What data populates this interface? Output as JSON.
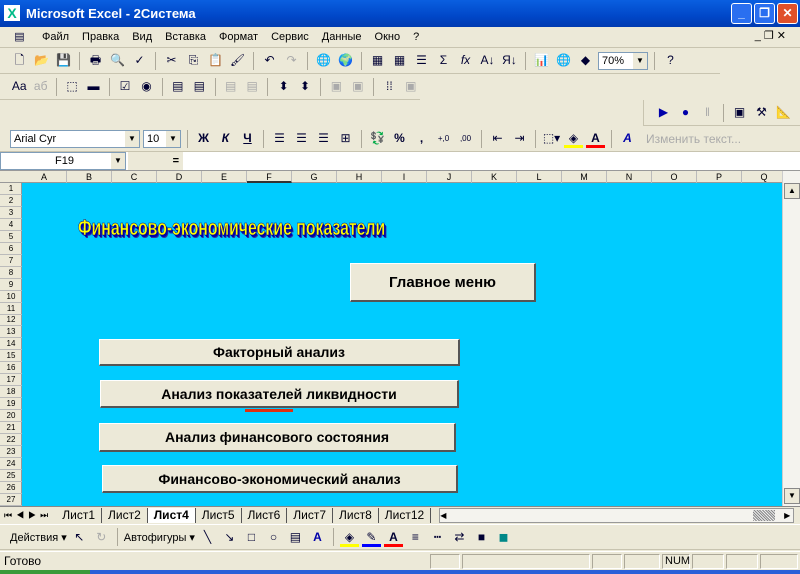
{
  "window": {
    "title": "Microsoft Excel - 2Система"
  },
  "menu": [
    "Файл",
    "Правка",
    "Вид",
    "Вставка",
    "Формат",
    "Сервис",
    "Данные",
    "Окно",
    "?"
  ],
  "toolbar": {
    "zoom": "70%",
    "font": "Arial Cyr",
    "size": "10",
    "bold": "Ж",
    "italic": "К",
    "underline": "Ч",
    "percent": "%",
    "comma": ",",
    "sigma": "Σ",
    "fx": "fx",
    "edit_text": "Изменить текст..."
  },
  "formula_bar": {
    "name_box": "F19",
    "equals": "=",
    "value": ""
  },
  "columns": [
    "A",
    "B",
    "C",
    "D",
    "E",
    "F",
    "G",
    "H",
    "I",
    "J",
    "K",
    "L",
    "M",
    "N",
    "O",
    "P",
    "Q"
  ],
  "rows": [
    "1",
    "2",
    "3",
    "4",
    "5",
    "6",
    "7",
    "8",
    "9",
    "10",
    "11",
    "12",
    "13",
    "14",
    "15",
    "16",
    "17",
    "18",
    "19",
    "20",
    "21",
    "22",
    "23",
    "24",
    "25",
    "26",
    "27"
  ],
  "sheet": {
    "title": "Финансово-экономические показатели",
    "main_menu": "Главное меню",
    "buttons": [
      "Факторный анализ",
      "Анализ показателей ликвидности",
      "Анализ финансового состояния",
      "Финансово-экономический анализ"
    ]
  },
  "tabs": [
    "Лист1",
    "Лист2",
    "Лист4",
    "Лист5",
    "Лист6",
    "Лист7",
    "Лист8",
    "Лист12"
  ],
  "active_tab": "Лист4",
  "drawing": {
    "actions": "Действия ▾",
    "autoshapes": "Автофигуры ▾"
  },
  "status": {
    "text": "Готово",
    "num": "NUM"
  }
}
